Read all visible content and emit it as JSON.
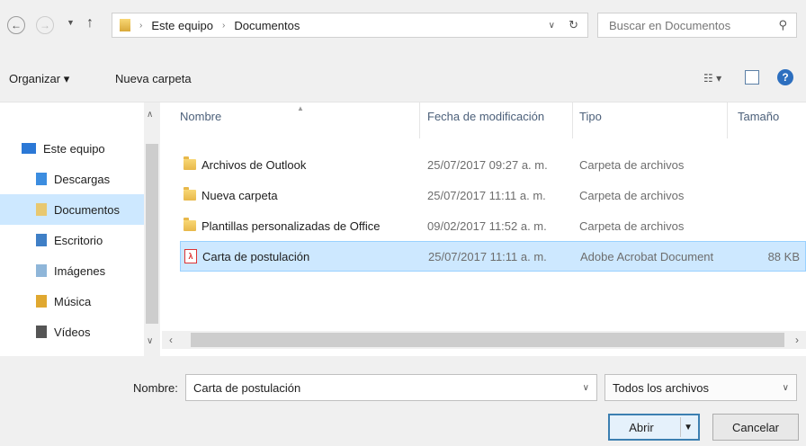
{
  "address": {
    "crumbs": [
      "Este equipo",
      "Documentos"
    ],
    "search_placeholder": "Buscar en Documentos"
  },
  "toolbar": {
    "organize_label": "Organizar ▾",
    "new_folder_label": "Nueva carpeta"
  },
  "sidebar": {
    "items": [
      {
        "label": "Este equipo"
      },
      {
        "label": "Descargas"
      },
      {
        "label": "Documentos"
      },
      {
        "label": "Escritorio"
      },
      {
        "label": "Imágenes"
      },
      {
        "label": "Música"
      },
      {
        "label": "Vídeos"
      }
    ]
  },
  "columns": {
    "name": "Nombre",
    "date": "Fecha de modificación",
    "type": "Tipo",
    "size": "Tamaño"
  },
  "files": [
    {
      "name": "Archivos de Outlook",
      "date": "25/07/2017 09:27 a. m.",
      "type": "Carpeta de archivos",
      "size": ""
    },
    {
      "name": "Nueva carpeta",
      "date": "25/07/2017 11:11 a. m.",
      "type": "Carpeta de archivos",
      "size": ""
    },
    {
      "name": "Plantillas personalizadas de Office",
      "date": "09/02/2017 11:52 a. m.",
      "type": "Carpeta de archivos",
      "size": ""
    },
    {
      "name": "Carta de postulación",
      "date": "25/07/2017 11:11 a. m.",
      "type": "Adobe Acrobat Document",
      "size": "88 KB"
    }
  ],
  "footer": {
    "filename_label": "Nombre:",
    "filename_value": "Carta de postulación",
    "filter_value": "Todos los archivos",
    "open_label": "Abrir",
    "cancel_label": "Cancelar"
  },
  "colors": {
    "selection": "#cde8ff",
    "accent": "#3c7fb1"
  }
}
